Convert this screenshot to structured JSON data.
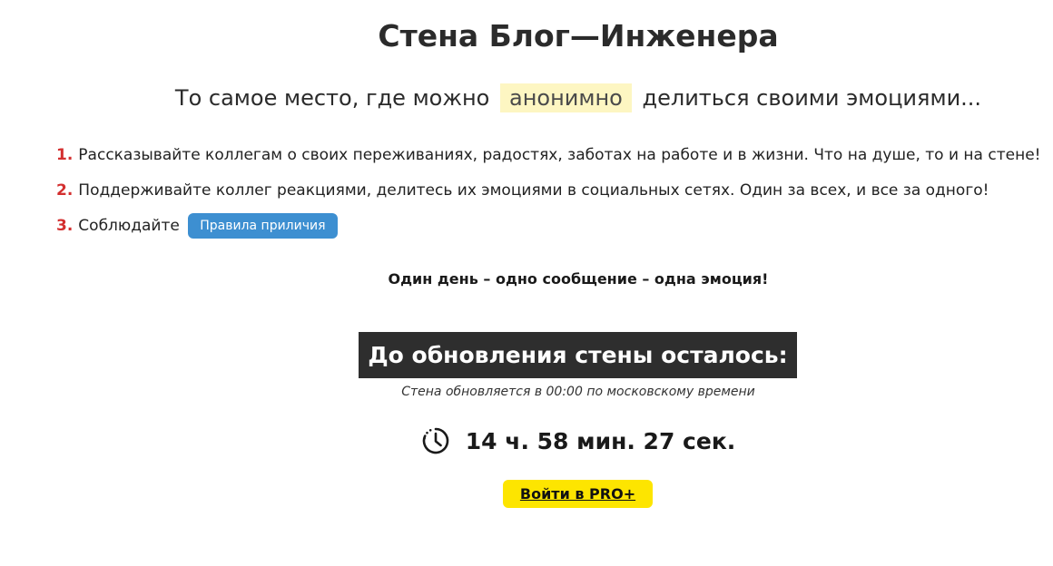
{
  "header": {
    "title": "Стена Блог—Инженера"
  },
  "subtitle": {
    "before": "То самое место, где можно",
    "highlight": "анонимно",
    "after": "делиться своими эмоциями..."
  },
  "rules": [
    {
      "number": "1.",
      "text": "Рассказывайте коллегам о своих переживаниях, радостях, заботах на работе и в жизни. Что на душе, то и на стене!"
    },
    {
      "number": "2.",
      "text": "Поддерживайте коллег реакциями, делитесь их эмоциями в социальных сетях. Один за всех, и все за одного!"
    },
    {
      "number": "3.",
      "text": "Соблюдайте",
      "button_label": "Правила приличия"
    }
  ],
  "motto": "Один день – одно сообщение – одна эмоция!",
  "countdown": {
    "heading": "До обновления стены осталось:",
    "note": "Стена обновляется в 00:00 по московскому времени",
    "timer": "14 ч. 58 мин. 27 сек.",
    "icon": "clock-icon"
  },
  "pro_button": {
    "label": "Войти в PRO+",
    "color": "#fde500"
  },
  "colors": {
    "rule_number": "#d32f2f",
    "rules_button": "#3d8fd1",
    "highlight_bg": "#fdf6c2",
    "countdown_bg": "#2e2e2e"
  }
}
